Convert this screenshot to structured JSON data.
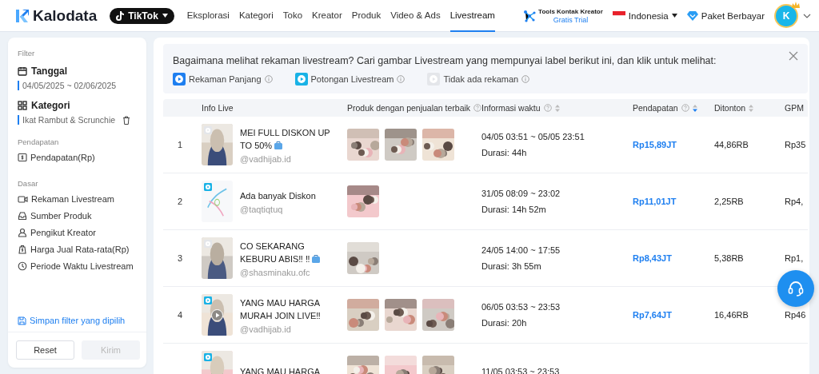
{
  "header": {
    "logo": "Kalodata",
    "platform": "TikTok",
    "nav": [
      {
        "label": "Eksplorasi",
        "selected": false
      },
      {
        "label": "Kategori",
        "selected": false
      },
      {
        "label": "Toko",
        "selected": false
      },
      {
        "label": "Kreator",
        "selected": false
      },
      {
        "label": "Produk",
        "selected": false
      },
      {
        "label": "Video & Ads",
        "selected": false
      },
      {
        "label": "Livestream",
        "selected": true
      }
    ],
    "tools": {
      "title": "Tools Kontak Kreator",
      "subtitle": "Gratis Trial"
    },
    "region": "Indonesia",
    "plan": "Paket Berbayar",
    "avatar": "K"
  },
  "sidebar": {
    "title": "Filter",
    "fields": [
      {
        "label": "Tanggal",
        "value": "04/05/2025 ~ 02/06/2025",
        "removable": false
      },
      {
        "label": "Kategori",
        "value": "Ikat Rambut & Scrunchie",
        "removable": true
      }
    ],
    "groups": [
      {
        "title": "Pendapatan",
        "items": [
          "Pendapatan(Rp)"
        ]
      },
      {
        "title": "Dasar",
        "items": [
          "Rekaman Livestream",
          "Sumber Produk",
          "Pengikut Kreator",
          "Harga Jual Rata-rata(Rp)",
          "Periode Waktu Livestream"
        ]
      }
    ],
    "save_link": "Simpan filter yang dipilih",
    "buttons": [
      {
        "label": "Reset",
        "disabled": false
      },
      {
        "label": "Kirim",
        "disabled": true
      }
    ]
  },
  "notice": {
    "text": "Bagaimana melihat rekaman livestream? Cari gambar Livestream yang mempunyai label berikut ini, dan klik untuk melihat:",
    "legend": [
      {
        "label": "Rekaman Panjang",
        "kind": "long"
      },
      {
        "label": "Potongan Livestream",
        "kind": "clip"
      },
      {
        "label": "Tidak ada rekaman",
        "kind": "none"
      }
    ]
  },
  "table": {
    "columns": [
      {
        "label": "Info Live",
        "help": false,
        "sortable": false
      },
      {
        "label": "Produk dengan penjualan terbaik",
        "help": true,
        "sortable": false
      },
      {
        "label": "Informasi waktu",
        "help": true,
        "sortable": true,
        "sorted": false
      },
      {
        "label": "Pendapatan",
        "help": true,
        "sortable": true,
        "sorted": true
      },
      {
        "label": "Ditonton",
        "help": false,
        "sortable": true,
        "sorted": false
      },
      {
        "label": "GPM",
        "help": false,
        "sortable": false
      }
    ],
    "rows": [
      {
        "rank": "1",
        "kind": "none",
        "playing": false,
        "title": "MEI FULL DISKON UP TO 50%",
        "emoji": true,
        "handle": "@vadhijab.id",
        "time": "04/05 03:51 ~ 05/05 23:51",
        "duration": "Durasi: 44h",
        "revenue": "Rp15,89JT",
        "views": "44,86RB",
        "gpm": "Rp35"
      },
      {
        "rank": "2",
        "kind": "clip",
        "playing": false,
        "title": "Ada banyak Diskon",
        "emoji": false,
        "handle": "@taqtiqtuq",
        "time": "31/05 08:09 ~ 23:02",
        "duration": "Durasi: 14h 52m",
        "revenue": "Rp11,01JT",
        "views": "2,25RB",
        "gpm": "Rp4,"
      },
      {
        "rank": "3",
        "kind": "none",
        "playing": false,
        "title": "CO SEKARANG KEBURU ABIS‼ ‼",
        "emoji": true,
        "handle": "@shasminaku.ofc",
        "time": "24/05 14:00 ~ 17:55",
        "duration": "Durasi: 3h 55m",
        "revenue": "Rp8,43JT",
        "views": "5,38RB",
        "gpm": "Rp1,"
      },
      {
        "rank": "4",
        "kind": "clip",
        "playing": true,
        "title": "YANG MAU HARGA MURAH JOIN LIVE‼",
        "emoji": false,
        "handle": "@vadhijab.id",
        "time": "06/05 03:53 ~ 23:53",
        "duration": "Durasi: 20h",
        "revenue": "Rp7,64JT",
        "views": "16,46RB",
        "gpm": "Rp46"
      },
      {
        "kind": "clip",
        "playing": false,
        "title": "YANG MAU HARGA",
        "emoji": false,
        "time": "11/05 03:53 ~ 23:53"
      }
    ]
  }
}
